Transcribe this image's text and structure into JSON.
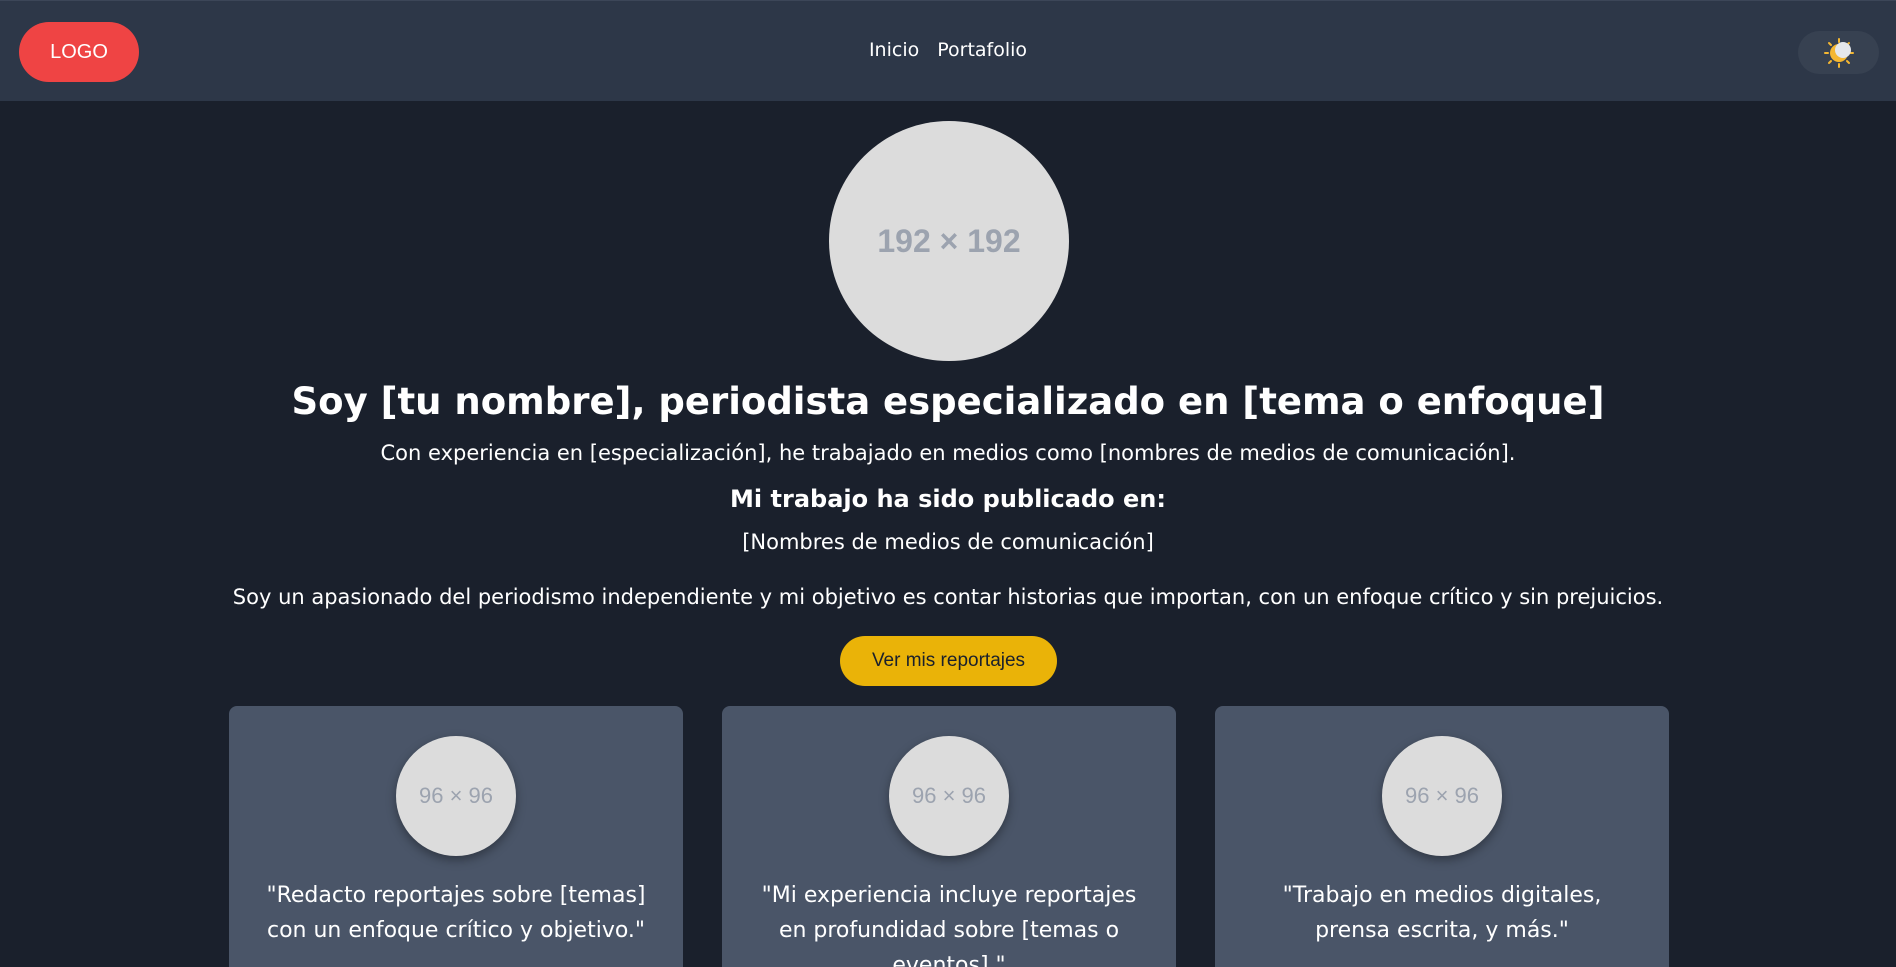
{
  "header": {
    "logo_label": "LOGO",
    "nav": [
      {
        "label": "Inicio"
      },
      {
        "label": "Portafolio"
      }
    ],
    "theme_toggle_icon": "sun-moon-icon"
  },
  "hero": {
    "avatar_placeholder": "192 × 192",
    "title": "Soy [tu nombre], periodista especializado en [tema o enfoque]",
    "subtitle": "Con experiencia en [especialización], he trabajado en medios como [nombres de medios de comunicación].",
    "published_heading": "Mi trabajo ha sido publicado en:",
    "published_list": "[Nombres de medios de comunicación]",
    "mission": "Soy un apasionado del periodismo independiente y mi objetivo es contar historias que importan, con un enfoque crítico y sin prejuicios.",
    "cta_label": "Ver mis reportajes"
  },
  "cards": [
    {
      "avatar_placeholder": "96 × 96",
      "quote": "\"Redacto reportajes sobre [temas] con un enfoque crítico y objetivo.\""
    },
    {
      "avatar_placeholder": "96 × 96",
      "quote": "\"Mi experiencia incluye reportajes en profundidad sobre [temas o eventos].\""
    },
    {
      "avatar_placeholder": "96 × 96",
      "quote": "\"Trabajo en medios digitales, prensa escrita, y más.\""
    }
  ],
  "colors": {
    "page_bg": "#1a202c",
    "navbar_bg": "#2d3748",
    "logo_bg": "#ef4444",
    "cta_bg": "#eab308",
    "card_bg": "#4a5568"
  }
}
